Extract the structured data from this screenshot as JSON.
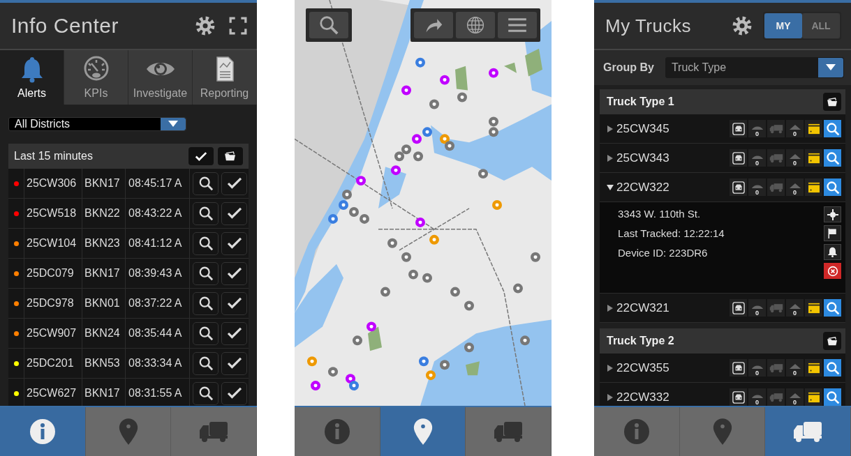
{
  "info_center": {
    "title": "Info Center",
    "tabs": [
      {
        "label": "Alerts",
        "kind": "bell",
        "selected": true
      },
      {
        "label": "KPIs",
        "kind": "gauge",
        "selected": false
      },
      {
        "label": "Investigate",
        "kind": "eye",
        "selected": false
      },
      {
        "label": "Reporting",
        "kind": "report",
        "selected": false
      }
    ],
    "district_select": {
      "value": "All Districts"
    },
    "alerts": {
      "header": "Last 15 minutes",
      "rows": [
        {
          "color": "#ff0000",
          "truck": "25CW306",
          "district": "BKN17",
          "time": "08:45:17 A"
        },
        {
          "color": "#ff0000",
          "truck": "25CW518",
          "district": "BKN22",
          "time": "08:43:22 A"
        },
        {
          "color": "#ff7f00",
          "truck": "25CW104",
          "district": "BKN23",
          "time": "08:41:12 A"
        },
        {
          "color": "#ff7f00",
          "truck": "25DC079",
          "district": "BKN17",
          "time": "08:39:43 A"
        },
        {
          "color": "#ff7f00",
          "truck": "25DC978",
          "district": "BKN01",
          "time": "08:37:22 A"
        },
        {
          "color": "#ff7f00",
          "truck": "25CW907",
          "district": "BKN24",
          "time": "08:35:44 A"
        },
        {
          "color": "#ffff00",
          "truck": "25DC201",
          "district": "BKN53",
          "time": "08:33:34 A"
        },
        {
          "color": "#ffff00",
          "truck": "25CW627",
          "district": "BKN17",
          "time": "08:31:55 A"
        }
      ]
    },
    "bottom_nav": [
      {
        "kind": "info",
        "selected": true
      },
      {
        "kind": "pin",
        "selected": false
      },
      {
        "kind": "truck",
        "selected": false
      }
    ]
  },
  "map_screen": {
    "bottom_nav": [
      {
        "kind": "info",
        "selected": false
      },
      {
        "kind": "pin",
        "selected": true
      },
      {
        "kind": "truck",
        "selected": false
      }
    ]
  },
  "my_trucks": {
    "title": "My Trucks",
    "toggle": [
      {
        "label": "MY",
        "selected": true
      },
      {
        "label": "ALL",
        "selected": false
      }
    ],
    "group_by": {
      "label": "Group By",
      "value": "Truck Type"
    },
    "groups": [
      {
        "name": "Truck Type 1",
        "trucks": [
          {
            "id": "25CW345",
            "expanded": false,
            "counts": [
              "0",
              "0"
            ]
          },
          {
            "id": "25CW343",
            "expanded": false,
            "counts": [
              "0",
              "0"
            ]
          },
          {
            "id": "22CW322",
            "expanded": true,
            "counts": [
              "0",
              "0"
            ],
            "details": [
              "3343 W. 110th St.",
              "Last Tracked: 12:22:14",
              "Device ID: 223DR6"
            ]
          },
          {
            "id": "22CW321",
            "expanded": false,
            "counts": [
              "0",
              "0"
            ]
          }
        ]
      },
      {
        "name": "Truck Type 2",
        "trucks": [
          {
            "id": "22CW355",
            "expanded": false,
            "counts": [
              "0",
              "0"
            ]
          },
          {
            "id": "22CW332",
            "expanded": false,
            "counts": [
              "0",
              "0"
            ]
          }
        ]
      }
    ],
    "bottom_nav": [
      {
        "kind": "info",
        "selected": false
      },
      {
        "kind": "pin",
        "selected": false
      },
      {
        "kind": "truck",
        "selected": true
      }
    ]
  }
}
